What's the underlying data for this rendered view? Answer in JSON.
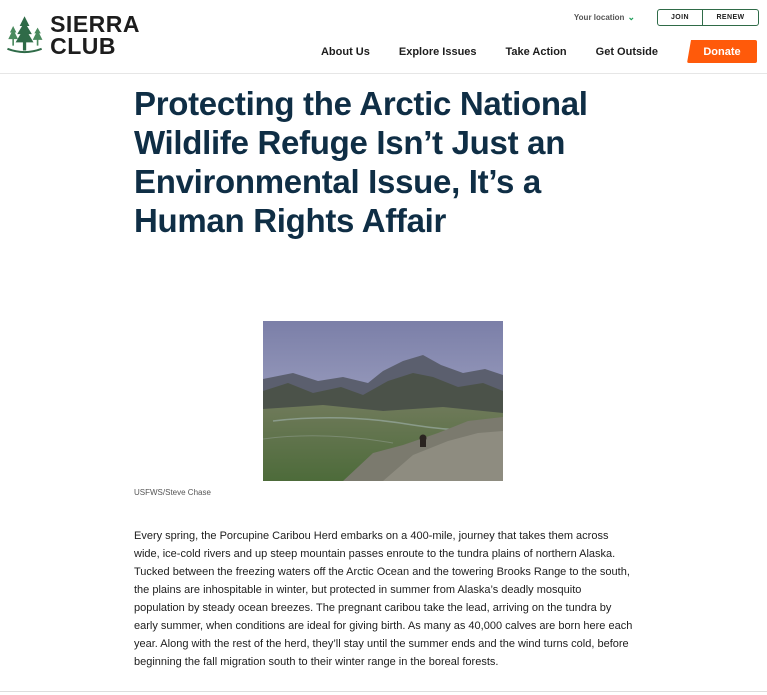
{
  "brand": {
    "logo_line1": "SIERRA",
    "logo_line2": "CLUB",
    "logo_icon": "sequoia-tree-icon",
    "brand_green": "#2f6b48",
    "accent_orange": "#ff5a0a",
    "title_color": "#0f2e45"
  },
  "utility": {
    "location_label": "Your location",
    "join_label": "JOIN",
    "renew_label": "RENEW"
  },
  "nav": {
    "items": [
      "About Us",
      "Explore Issues",
      "Take Action",
      "Get Outside"
    ],
    "donate_label": "Donate"
  },
  "article": {
    "title": "Protecting the Arctic National Wildlife Refuge Isn’t Just an Environmental Issue, It’s a Human Rights Affair",
    "photo_credit": "USFWS/Steve Chase",
    "paragraph": "Every spring, the Porcupine Caribou Herd embarks on a 400-mile, journey that takes them across wide, ice-cold rivers and up steep mountain passes enroute to the tundra plains of northern Alaska. Tucked between the freezing waters off the Arctic Ocean and the towering Brooks Range to the south, the plains are inhospitable in winter, but protected in summer from Alaska’s deadly mosquito population by steady ocean breezes. The pregnant caribou take the lead, arriving on the tundra by early summer, when conditions are ideal for giving birth. As many as 40,000 calves are born here each year. Along with the rest of the herd, they’ll stay until the summer ends and the wind turns cold, before beginning the fall migration south to their winter range in the boreal forests."
  }
}
